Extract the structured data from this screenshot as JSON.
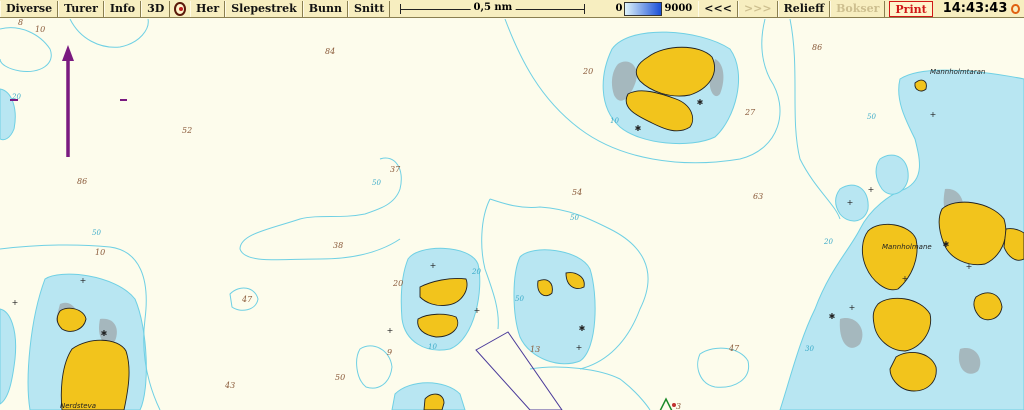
{
  "toolbar": {
    "menu": [
      "Diverse",
      "Turer",
      "Info",
      "3D"
    ],
    "tools": [
      "Her",
      "Slepestrek",
      "Bunn",
      "Snitt"
    ],
    "scale_label": "0,5 nm",
    "depth_min": "0",
    "depth_max": "9000",
    "back": "<<<",
    "forward": ">>>",
    "relief": "Relieff",
    "bokser": "Bokser",
    "print": "Print",
    "time": "14:43:43"
  },
  "map": {
    "place_names": [
      "Mannholmtaran",
      "Mannholmane",
      "Nerdsteva"
    ],
    "depth_soundings": [
      "10",
      "8",
      "84",
      "86",
      "52",
      "86",
      "37",
      "38",
      "54",
      "63",
      "27",
      "47",
      "43",
      "50",
      "13",
      "20",
      "9",
      "47",
      "10",
      "20",
      "3"
    ],
    "contour_labels": [
      "50",
      "50",
      "50",
      "20",
      "20",
      "10",
      "10",
      "20",
      "50",
      "50",
      "30"
    ]
  },
  "colors": {
    "sea": "#fdfcec",
    "shallow": "#b8e6f2",
    "land": "#f2c41c",
    "contour": "#6fd0e4",
    "depth_text": "#8a5a3a",
    "north_arrow": "#7a1a80"
  }
}
